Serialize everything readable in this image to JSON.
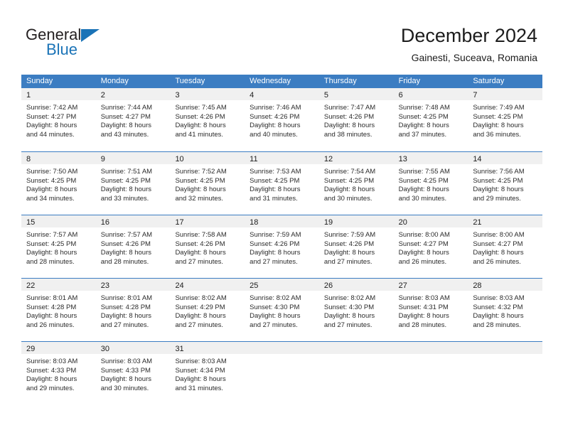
{
  "brand": {
    "word_one": "General",
    "word_two": "Blue",
    "triangle_icon": "triangle-icon",
    "accent_color": "#1a73b7"
  },
  "header": {
    "title": "December 2024",
    "subtitle": "Gainesti, Suceava, Romania"
  },
  "calendar": {
    "header_color": "#3c7dc2",
    "daynum_band_color": "#f0f0f0",
    "day_names": [
      "Sunday",
      "Monday",
      "Tuesday",
      "Wednesday",
      "Thursday",
      "Friday",
      "Saturday"
    ],
    "weeks": [
      [
        {
          "day": "1",
          "lines": [
            "Sunrise: 7:42 AM",
            "Sunset: 4:27 PM",
            "Daylight: 8 hours",
            "and 44 minutes."
          ]
        },
        {
          "day": "2",
          "lines": [
            "Sunrise: 7:44 AM",
            "Sunset: 4:27 PM",
            "Daylight: 8 hours",
            "and 43 minutes."
          ]
        },
        {
          "day": "3",
          "lines": [
            "Sunrise: 7:45 AM",
            "Sunset: 4:26 PM",
            "Daylight: 8 hours",
            "and 41 minutes."
          ]
        },
        {
          "day": "4",
          "lines": [
            "Sunrise: 7:46 AM",
            "Sunset: 4:26 PM",
            "Daylight: 8 hours",
            "and 40 minutes."
          ]
        },
        {
          "day": "5",
          "lines": [
            "Sunrise: 7:47 AM",
            "Sunset: 4:26 PM",
            "Daylight: 8 hours",
            "and 38 minutes."
          ]
        },
        {
          "day": "6",
          "lines": [
            "Sunrise: 7:48 AM",
            "Sunset: 4:25 PM",
            "Daylight: 8 hours",
            "and 37 minutes."
          ]
        },
        {
          "day": "7",
          "lines": [
            "Sunrise: 7:49 AM",
            "Sunset: 4:25 PM",
            "Daylight: 8 hours",
            "and 36 minutes."
          ]
        }
      ],
      [
        {
          "day": "8",
          "lines": [
            "Sunrise: 7:50 AM",
            "Sunset: 4:25 PM",
            "Daylight: 8 hours",
            "and 34 minutes."
          ]
        },
        {
          "day": "9",
          "lines": [
            "Sunrise: 7:51 AM",
            "Sunset: 4:25 PM",
            "Daylight: 8 hours",
            "and 33 minutes."
          ]
        },
        {
          "day": "10",
          "lines": [
            "Sunrise: 7:52 AM",
            "Sunset: 4:25 PM",
            "Daylight: 8 hours",
            "and 32 minutes."
          ]
        },
        {
          "day": "11",
          "lines": [
            "Sunrise: 7:53 AM",
            "Sunset: 4:25 PM",
            "Daylight: 8 hours",
            "and 31 minutes."
          ]
        },
        {
          "day": "12",
          "lines": [
            "Sunrise: 7:54 AM",
            "Sunset: 4:25 PM",
            "Daylight: 8 hours",
            "and 30 minutes."
          ]
        },
        {
          "day": "13",
          "lines": [
            "Sunrise: 7:55 AM",
            "Sunset: 4:25 PM",
            "Daylight: 8 hours",
            "and 30 minutes."
          ]
        },
        {
          "day": "14",
          "lines": [
            "Sunrise: 7:56 AM",
            "Sunset: 4:25 PM",
            "Daylight: 8 hours",
            "and 29 minutes."
          ]
        }
      ],
      [
        {
          "day": "15",
          "lines": [
            "Sunrise: 7:57 AM",
            "Sunset: 4:25 PM",
            "Daylight: 8 hours",
            "and 28 minutes."
          ]
        },
        {
          "day": "16",
          "lines": [
            "Sunrise: 7:57 AM",
            "Sunset: 4:26 PM",
            "Daylight: 8 hours",
            "and 28 minutes."
          ]
        },
        {
          "day": "17",
          "lines": [
            "Sunrise: 7:58 AM",
            "Sunset: 4:26 PM",
            "Daylight: 8 hours",
            "and 27 minutes."
          ]
        },
        {
          "day": "18",
          "lines": [
            "Sunrise: 7:59 AM",
            "Sunset: 4:26 PM",
            "Daylight: 8 hours",
            "and 27 minutes."
          ]
        },
        {
          "day": "19",
          "lines": [
            "Sunrise: 7:59 AM",
            "Sunset: 4:26 PM",
            "Daylight: 8 hours",
            "and 27 minutes."
          ]
        },
        {
          "day": "20",
          "lines": [
            "Sunrise: 8:00 AM",
            "Sunset: 4:27 PM",
            "Daylight: 8 hours",
            "and 26 minutes."
          ]
        },
        {
          "day": "21",
          "lines": [
            "Sunrise: 8:00 AM",
            "Sunset: 4:27 PM",
            "Daylight: 8 hours",
            "and 26 minutes."
          ]
        }
      ],
      [
        {
          "day": "22",
          "lines": [
            "Sunrise: 8:01 AM",
            "Sunset: 4:28 PM",
            "Daylight: 8 hours",
            "and 26 minutes."
          ]
        },
        {
          "day": "23",
          "lines": [
            "Sunrise: 8:01 AM",
            "Sunset: 4:28 PM",
            "Daylight: 8 hours",
            "and 27 minutes."
          ]
        },
        {
          "day": "24",
          "lines": [
            "Sunrise: 8:02 AM",
            "Sunset: 4:29 PM",
            "Daylight: 8 hours",
            "and 27 minutes."
          ]
        },
        {
          "day": "25",
          "lines": [
            "Sunrise: 8:02 AM",
            "Sunset: 4:30 PM",
            "Daylight: 8 hours",
            "and 27 minutes."
          ]
        },
        {
          "day": "26",
          "lines": [
            "Sunrise: 8:02 AM",
            "Sunset: 4:30 PM",
            "Daylight: 8 hours",
            "and 27 minutes."
          ]
        },
        {
          "day": "27",
          "lines": [
            "Sunrise: 8:03 AM",
            "Sunset: 4:31 PM",
            "Daylight: 8 hours",
            "and 28 minutes."
          ]
        },
        {
          "day": "28",
          "lines": [
            "Sunrise: 8:03 AM",
            "Sunset: 4:32 PM",
            "Daylight: 8 hours",
            "and 28 minutes."
          ]
        }
      ],
      [
        {
          "day": "29",
          "lines": [
            "Sunrise: 8:03 AM",
            "Sunset: 4:33 PM",
            "Daylight: 8 hours",
            "and 29 minutes."
          ]
        },
        {
          "day": "30",
          "lines": [
            "Sunrise: 8:03 AM",
            "Sunset: 4:33 PM",
            "Daylight: 8 hours",
            "and 30 minutes."
          ]
        },
        {
          "day": "31",
          "lines": [
            "Sunrise: 8:03 AM",
            "Sunset: 4:34 PM",
            "Daylight: 8 hours",
            "and 31 minutes."
          ]
        },
        {
          "day": "",
          "lines": []
        },
        {
          "day": "",
          "lines": []
        },
        {
          "day": "",
          "lines": []
        },
        {
          "day": "",
          "lines": []
        }
      ]
    ]
  }
}
